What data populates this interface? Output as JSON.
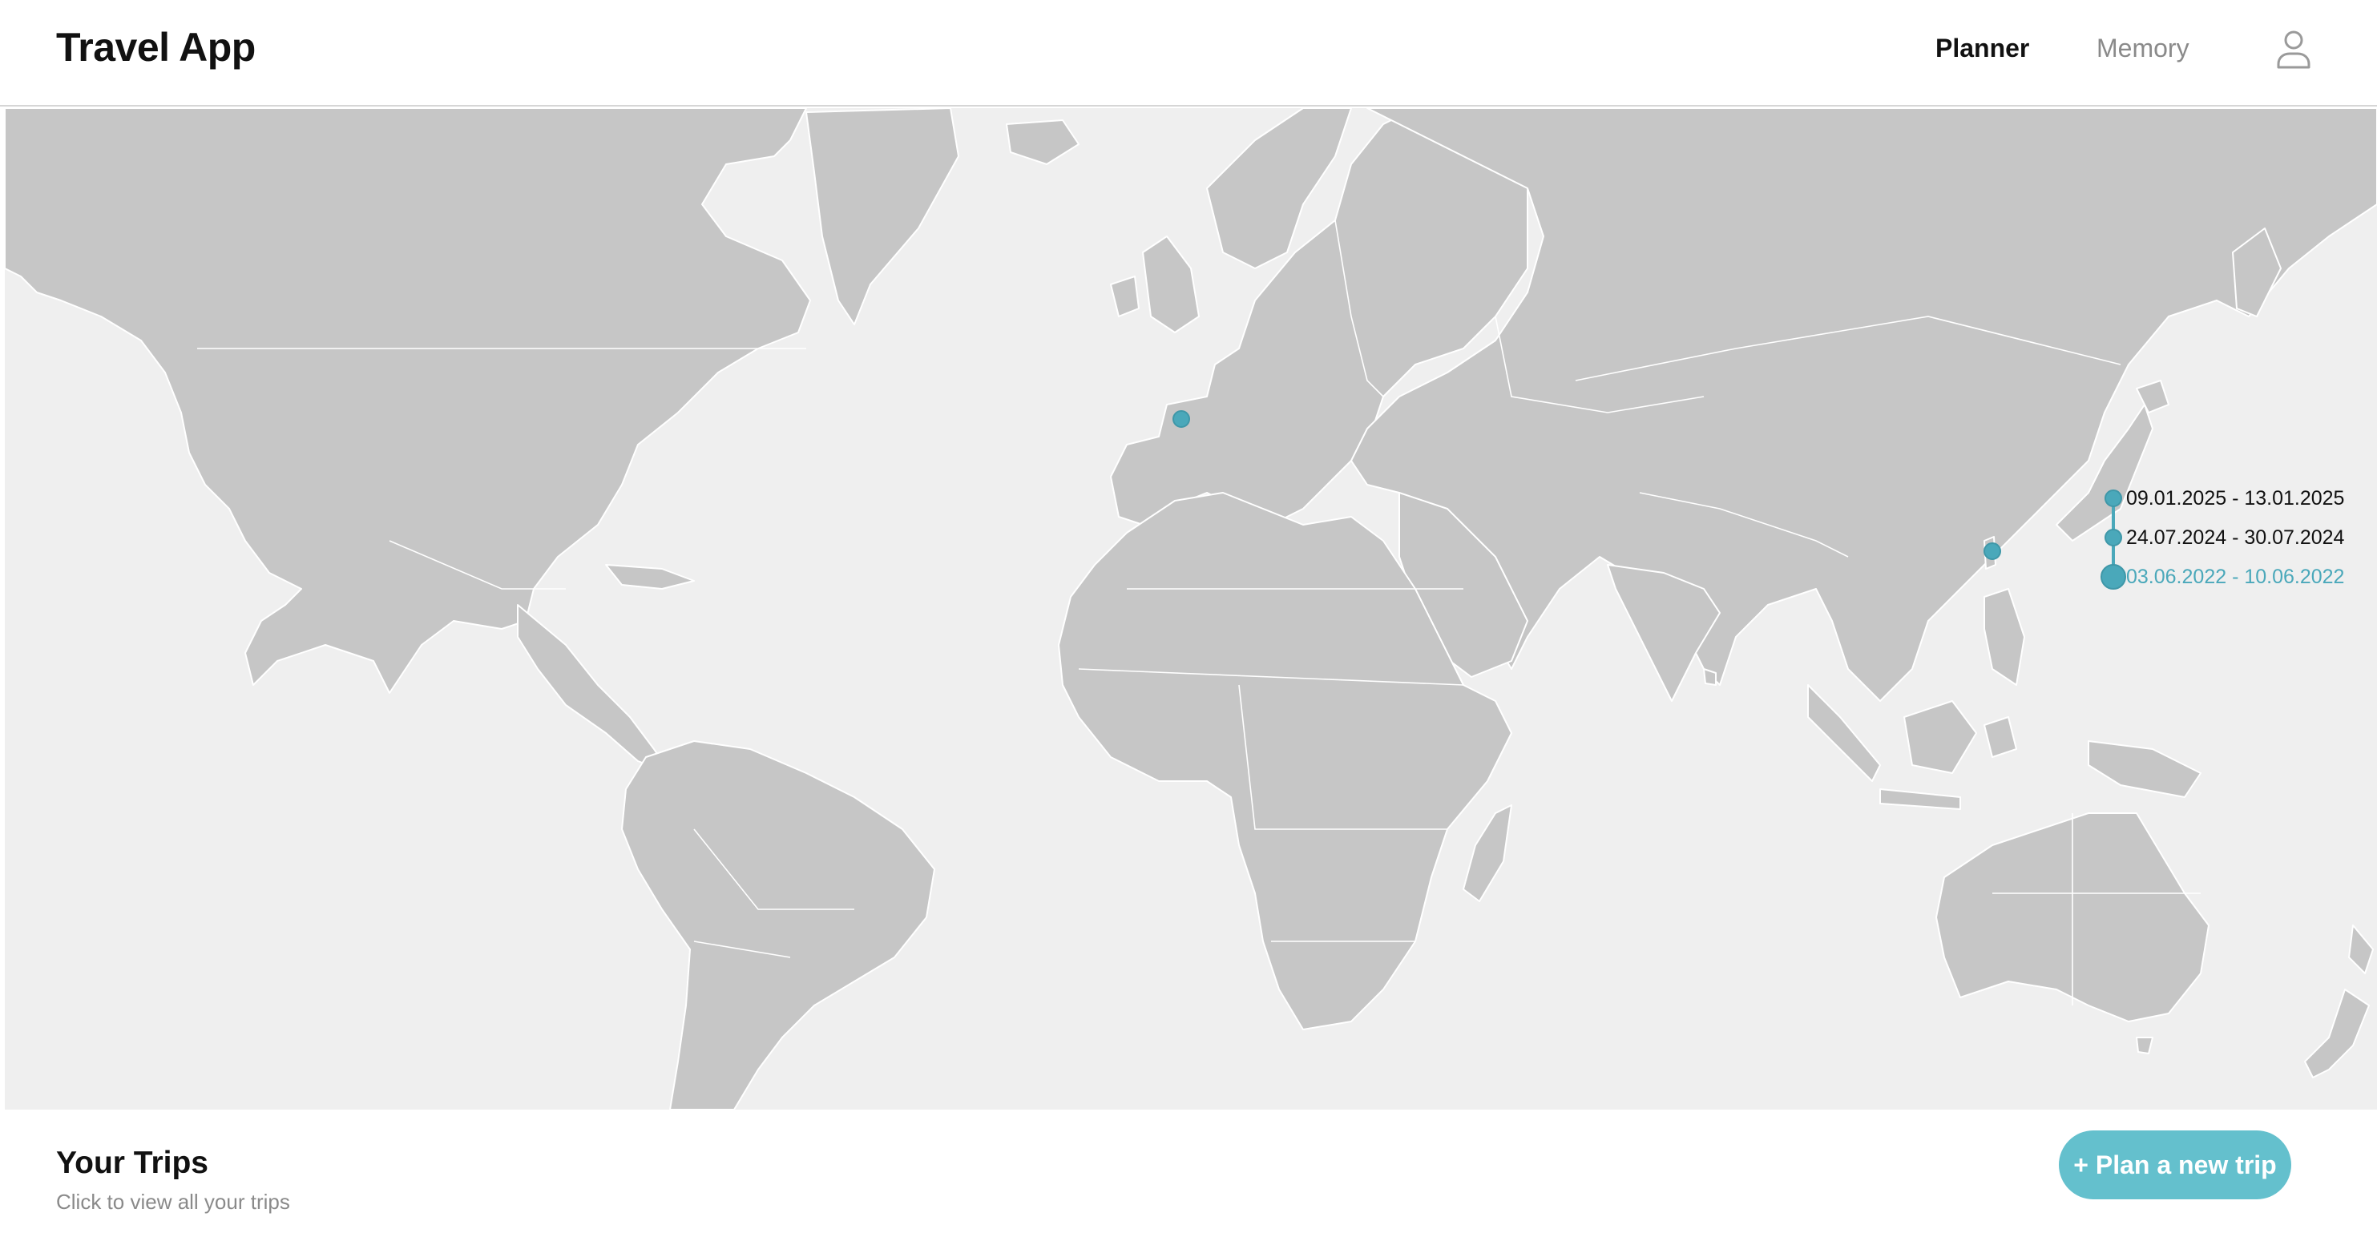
{
  "app": {
    "title": "Travel App"
  },
  "nav": {
    "planner_label": "Planner",
    "memory_label": "Memory",
    "active_tab": "Planner",
    "user_icon": "user-icon"
  },
  "map": {
    "land_color": "#c6c6c6",
    "ocean_color": "#efefef",
    "marker_color": "#4aa8ba",
    "trips": [
      {
        "date_range": "09.01.2025 - 13.01.2025",
        "active": false
      },
      {
        "date_range": "24.07.2024 - 30.07.2024",
        "active": false
      },
      {
        "date_range": "03.06.2022 - 10.06.2022",
        "active": true
      }
    ]
  },
  "trips_panel": {
    "title": "Your Trips",
    "subtitle": "Click to view all your trips",
    "plan_button_label": "+ Plan a new trip",
    "button_color": "#64c0cd"
  }
}
